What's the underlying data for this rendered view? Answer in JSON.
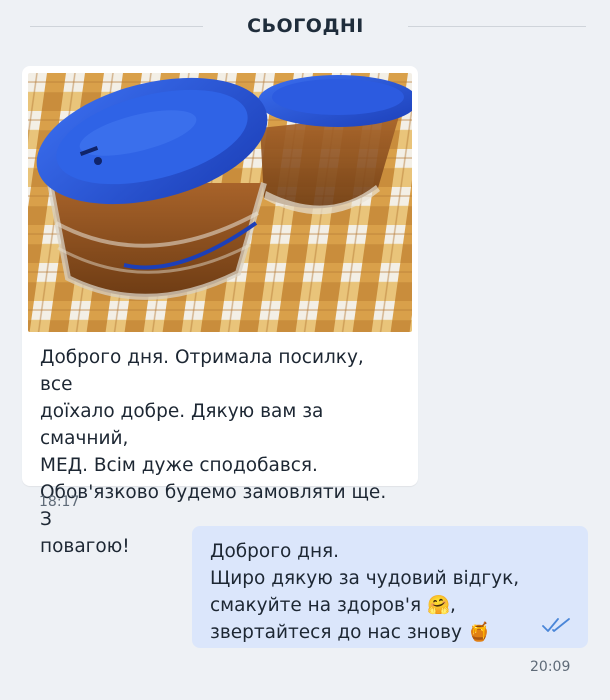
{
  "date_separator": "СЬОГОДНІ",
  "incoming": {
    "text": "Доброго дня. Отримала посилку, все\nдоїхало добре. Дякую вам за смачний,\nМЕД. Всім дуже сподобався.\nОбов'язково будемо замовляти ще. З\nповагою!",
    "time": "18:17"
  },
  "outgoing": {
    "text": "Доброго дня.\nЩиро дякую за чудовий відгук,\nсмакуйте на здоров'я 🤗,\nзвертайтеся до нас знову 🍯",
    "time": "20:09",
    "status_icon": "double-check-icon"
  },
  "colors": {
    "page_bg": "#eef1f5",
    "incoming_bubble": "#ffffff",
    "outgoing_bubble": "#dbe6fb",
    "check_color": "#4a86d8"
  }
}
